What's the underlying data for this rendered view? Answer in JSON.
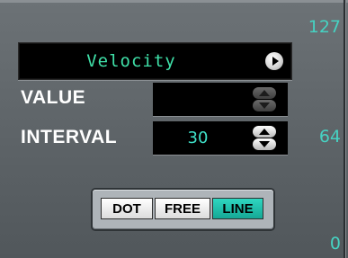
{
  "parameter": {
    "selected": "Velocity",
    "menu_icon": "right-arrow-icon"
  },
  "rows": {
    "value": {
      "label": "VALUE",
      "field_value": ""
    },
    "interval": {
      "label": "INTERVAL",
      "field_value": "30"
    }
  },
  "mode": {
    "dot": "DOT",
    "free": "FREE",
    "line": "LINE",
    "selected": "LINE"
  },
  "scale": {
    "top": "127",
    "mid": "64",
    "bottom": "0"
  },
  "colors": {
    "panel": "#5f6569",
    "display_text": "#3fe0a8",
    "field_text": "#3fe0c8",
    "accent": "#1fc4b0",
    "label_text": "#ffffff"
  }
}
